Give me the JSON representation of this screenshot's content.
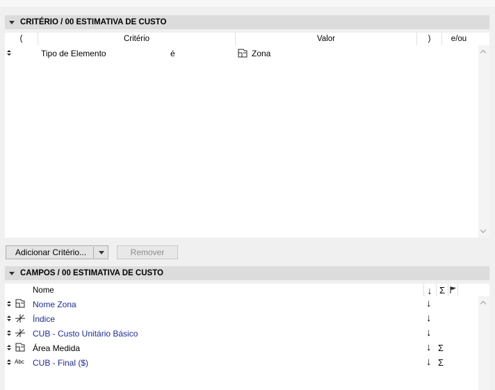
{
  "criteria": {
    "title": "CRITÉRIO / 00 ESTIMATIVA DE CUSTO",
    "columns": {
      "open_paren": "(",
      "criterion": "Critério",
      "value": "Valor",
      "close_paren": ")",
      "andor": "e/ou"
    },
    "rows": [
      {
        "criterion": "Tipo de Elemento",
        "operator": "é",
        "value": "Zona",
        "value_icon": "zone-icon"
      }
    ],
    "add_button": "Adicionar Critério...",
    "remove_button": "Remover"
  },
  "fields": {
    "title": "CAMPOS / 00 ESTIMATIVA DE CUSTO",
    "columns": {
      "name": "Nome",
      "sort_symbol": "↓",
      "sum_symbol": "Σ",
      "flag_icon": "flag-icon"
    },
    "rows": [
      {
        "icon": "zone-icon",
        "name": "Nome Zona",
        "sort": "↓",
        "sum": ""
      },
      {
        "icon": "axis-icon",
        "name": "Índice",
        "sort": "↓",
        "sum": ""
      },
      {
        "icon": "axis-icon",
        "name": "CUB - Custo Unitário Básico",
        "sort": "↓",
        "sum": ""
      },
      {
        "icon": "zone-icon",
        "name": "Área Medida",
        "sort": "↓",
        "sum": "Σ"
      },
      {
        "icon": "text-abc-icon",
        "icon_text": "Abc",
        "name": "CUB - Final ($)",
        "sort": "↓",
        "sum": "Σ"
      }
    ]
  }
}
